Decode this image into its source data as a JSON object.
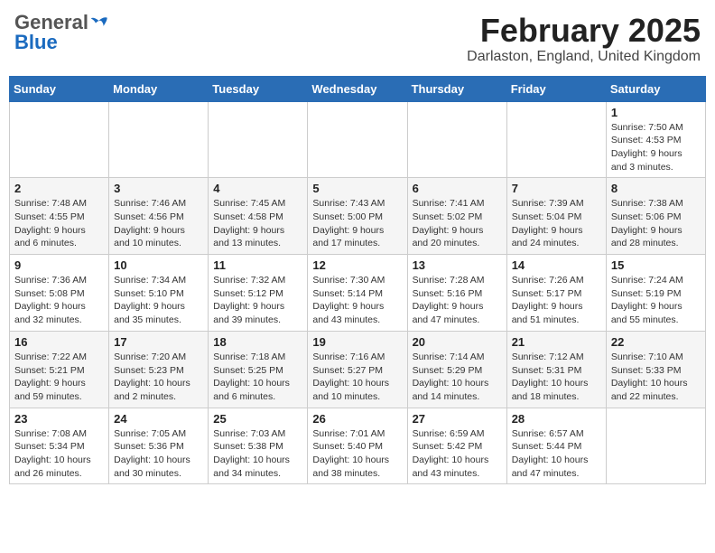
{
  "logo": {
    "general": "General",
    "blue": "Blue"
  },
  "header": {
    "month": "February 2025",
    "location": "Darlaston, England, United Kingdom"
  },
  "weekdays": [
    "Sunday",
    "Monday",
    "Tuesday",
    "Wednesday",
    "Thursday",
    "Friday",
    "Saturday"
  ],
  "weeks": [
    [
      {
        "day": "",
        "info": ""
      },
      {
        "day": "",
        "info": ""
      },
      {
        "day": "",
        "info": ""
      },
      {
        "day": "",
        "info": ""
      },
      {
        "day": "",
        "info": ""
      },
      {
        "day": "",
        "info": ""
      },
      {
        "day": "1",
        "info": "Sunrise: 7:50 AM\nSunset: 4:53 PM\nDaylight: 9 hours and 3 minutes."
      }
    ],
    [
      {
        "day": "2",
        "info": "Sunrise: 7:48 AM\nSunset: 4:55 PM\nDaylight: 9 hours and 6 minutes."
      },
      {
        "day": "3",
        "info": "Sunrise: 7:46 AM\nSunset: 4:56 PM\nDaylight: 9 hours and 10 minutes."
      },
      {
        "day": "4",
        "info": "Sunrise: 7:45 AM\nSunset: 4:58 PM\nDaylight: 9 hours and 13 minutes."
      },
      {
        "day": "5",
        "info": "Sunrise: 7:43 AM\nSunset: 5:00 PM\nDaylight: 9 hours and 17 minutes."
      },
      {
        "day": "6",
        "info": "Sunrise: 7:41 AM\nSunset: 5:02 PM\nDaylight: 9 hours and 20 minutes."
      },
      {
        "day": "7",
        "info": "Sunrise: 7:39 AM\nSunset: 5:04 PM\nDaylight: 9 hours and 24 minutes."
      },
      {
        "day": "8",
        "info": "Sunrise: 7:38 AM\nSunset: 5:06 PM\nDaylight: 9 hours and 28 minutes."
      }
    ],
    [
      {
        "day": "9",
        "info": "Sunrise: 7:36 AM\nSunset: 5:08 PM\nDaylight: 9 hours and 32 minutes."
      },
      {
        "day": "10",
        "info": "Sunrise: 7:34 AM\nSunset: 5:10 PM\nDaylight: 9 hours and 35 minutes."
      },
      {
        "day": "11",
        "info": "Sunrise: 7:32 AM\nSunset: 5:12 PM\nDaylight: 9 hours and 39 minutes."
      },
      {
        "day": "12",
        "info": "Sunrise: 7:30 AM\nSunset: 5:14 PM\nDaylight: 9 hours and 43 minutes."
      },
      {
        "day": "13",
        "info": "Sunrise: 7:28 AM\nSunset: 5:16 PM\nDaylight: 9 hours and 47 minutes."
      },
      {
        "day": "14",
        "info": "Sunrise: 7:26 AM\nSunset: 5:17 PM\nDaylight: 9 hours and 51 minutes."
      },
      {
        "day": "15",
        "info": "Sunrise: 7:24 AM\nSunset: 5:19 PM\nDaylight: 9 hours and 55 minutes."
      }
    ],
    [
      {
        "day": "16",
        "info": "Sunrise: 7:22 AM\nSunset: 5:21 PM\nDaylight: 9 hours and 59 minutes."
      },
      {
        "day": "17",
        "info": "Sunrise: 7:20 AM\nSunset: 5:23 PM\nDaylight: 10 hours and 2 minutes."
      },
      {
        "day": "18",
        "info": "Sunrise: 7:18 AM\nSunset: 5:25 PM\nDaylight: 10 hours and 6 minutes."
      },
      {
        "day": "19",
        "info": "Sunrise: 7:16 AM\nSunset: 5:27 PM\nDaylight: 10 hours and 10 minutes."
      },
      {
        "day": "20",
        "info": "Sunrise: 7:14 AM\nSunset: 5:29 PM\nDaylight: 10 hours and 14 minutes."
      },
      {
        "day": "21",
        "info": "Sunrise: 7:12 AM\nSunset: 5:31 PM\nDaylight: 10 hours and 18 minutes."
      },
      {
        "day": "22",
        "info": "Sunrise: 7:10 AM\nSunset: 5:33 PM\nDaylight: 10 hours and 22 minutes."
      }
    ],
    [
      {
        "day": "23",
        "info": "Sunrise: 7:08 AM\nSunset: 5:34 PM\nDaylight: 10 hours and 26 minutes."
      },
      {
        "day": "24",
        "info": "Sunrise: 7:05 AM\nSunset: 5:36 PM\nDaylight: 10 hours and 30 minutes."
      },
      {
        "day": "25",
        "info": "Sunrise: 7:03 AM\nSunset: 5:38 PM\nDaylight: 10 hours and 34 minutes."
      },
      {
        "day": "26",
        "info": "Sunrise: 7:01 AM\nSunset: 5:40 PM\nDaylight: 10 hours and 38 minutes."
      },
      {
        "day": "27",
        "info": "Sunrise: 6:59 AM\nSunset: 5:42 PM\nDaylight: 10 hours and 43 minutes."
      },
      {
        "day": "28",
        "info": "Sunrise: 6:57 AM\nSunset: 5:44 PM\nDaylight: 10 hours and 47 minutes."
      },
      {
        "day": "",
        "info": ""
      }
    ]
  ]
}
